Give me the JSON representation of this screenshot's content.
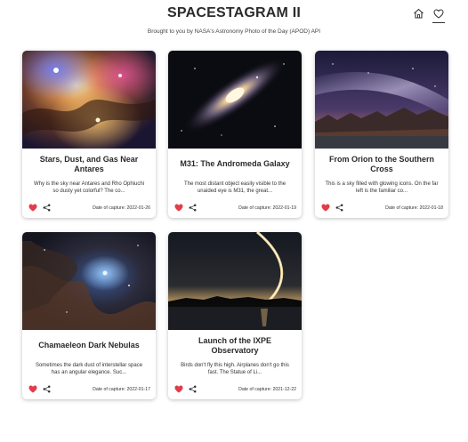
{
  "header": {
    "title": "SPACESTAGRAM II",
    "subtitle": "Brought to you by NASA's Astronomy Photo of the Day (APOD) API"
  },
  "nav": {
    "home_icon": "home-icon",
    "favorites_icon": "heart-outline-icon"
  },
  "cards": [
    {
      "title": "Stars, Dust, and Gas Near Antares",
      "description": "Why is the sky near Antares and Rho Ophiuchi so dusty yet colorful? The co...",
      "date": "Date of capture: 2022-01-26"
    },
    {
      "title": "M31: The Andromeda Galaxy",
      "description": "The most distant object easily visible to the unaided eye is M31, the great...",
      "date": "Date of capture: 2022-01-19"
    },
    {
      "title": "From Orion to the Southern Cross",
      "description": "This is a sky filled with glowing icons. On the far left is the familiar co...",
      "date": "Date of capture: 2022-01-18"
    },
    {
      "title": "Chamaeleon Dark Nebulas",
      "description": "Sometimes the dark dust of interstellar space has an angular elegance. Suc...",
      "date": "Date of capture: 2022-01-17"
    },
    {
      "title": "Launch of the IXPE Observatory",
      "description": "Birds don't fly this high. Airplanes don't go this fast. The Statue of Li...",
      "date": "Date of capture: 2021-12-22"
    }
  ],
  "colors": {
    "heart": "#e23d4a",
    "text": "#2b2b2b"
  }
}
